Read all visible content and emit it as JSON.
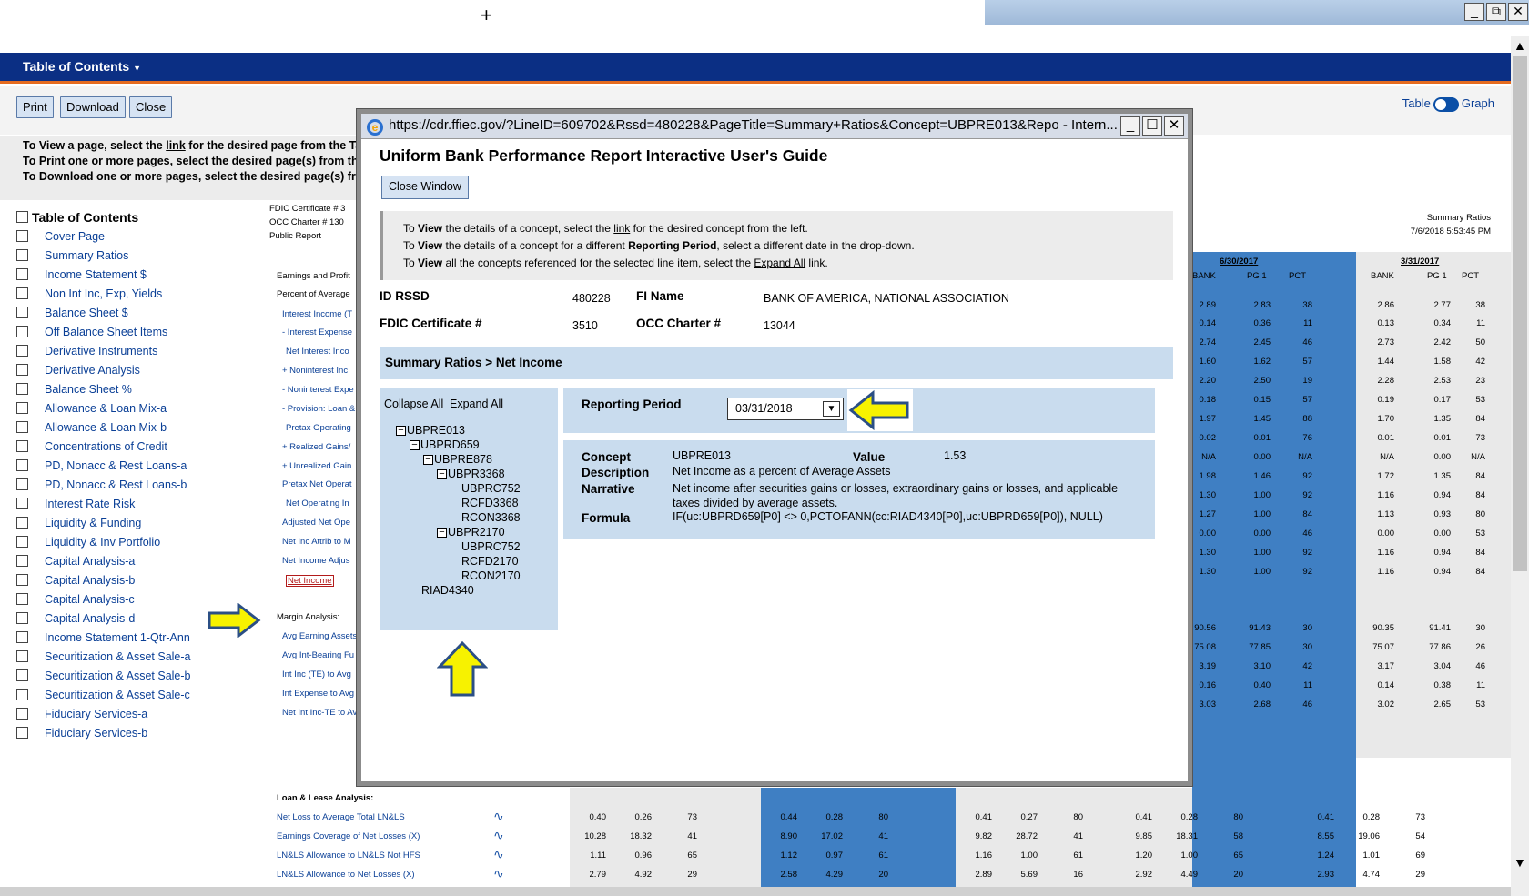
{
  "window": {
    "plus_cursor": "+",
    "controls": [
      "_",
      "⧉",
      "✕"
    ]
  },
  "nav": {
    "menu_label": "Table of Contents"
  },
  "toolbar": {
    "print": "Print",
    "download": "Download",
    "close": "Close",
    "table": "Table",
    "graph": "Graph"
  },
  "instructions": {
    "view_prefix": "To View a page, select the ",
    "view_link": "link",
    "view_suffix": " for the desired page from the Tab",
    "print": "To Print one or more pages, select the desired page(s) from the",
    "download": "To Download one or more pages, select the desired page(s) fror"
  },
  "toc": {
    "title": "Table of Contents",
    "items": [
      "Cover Page",
      "Summary Ratios",
      "Income Statement $",
      "Non Int Inc, Exp, Yields",
      "Balance Sheet $",
      "Off Balance Sheet Items",
      "Derivative Instruments",
      "Derivative Analysis",
      "Balance Sheet %",
      "Allowance & Loan Mix-a",
      "Allowance & Loan Mix-b",
      "Concentrations of Credit",
      "PD, Nonacc & Rest Loans-a",
      "PD, Nonacc & Rest Loans-b",
      "Interest Rate Risk",
      "Liquidity & Funding",
      "Liquidity & Inv Portfolio",
      "Capital Analysis-a",
      "Capital Analysis-b",
      "Capital Analysis-c",
      "Capital Analysis-d",
      "Income Statement 1-Qtr-Ann",
      "Securitization & Asset Sale-a",
      "Securitization & Asset Sale-b",
      "Securitization & Asset Sale-c",
      "Fiduciary Services-a",
      "Fiduciary Services-b"
    ]
  },
  "report": {
    "header_left": [
      "FDIC Certificate # 3",
      "OCC Charter # 130",
      "Public Report"
    ],
    "header_right": [
      "Summary Ratios",
      "7/6/2018 5:53:45 PM"
    ],
    "dates": [
      "6/30/2017",
      "3/31/2017"
    ],
    "col_heads": [
      "BANK",
      "PG 1",
      "PCT",
      "BANK",
      "PG 1",
      "PCT"
    ],
    "row_labels": [
      "Earnings and Profit",
      "Percent of Average",
      "Interest Income (T",
      "- Interest Expense",
      "Net Interest Inco",
      "+ Noninterest Inc",
      "- Noninterest Expe",
      "- Provision: Loan &",
      "Pretax Operating",
      "+ Realized Gains/",
      "+ Unrealized Gain",
      "Pretax Net Operat",
      "Net Operating In",
      "Adjusted Net Ope",
      "Net Inc Attrib to M",
      "Net Income Adjus",
      "Net Income",
      "Margin Analysis:",
      "Avg Earning Assets",
      "Avg Int-Bearing Fu",
      "Int Inc (TE) to Avg",
      "Int Expense to Avg",
      "Net Int Inc-TE to Av"
    ],
    "right_rows": [
      [
        "2.89",
        "2.83",
        "38",
        "2.86",
        "2.77",
        "38"
      ],
      [
        "0.14",
        "0.36",
        "11",
        "0.13",
        "0.34",
        "11"
      ],
      [
        "2.74",
        "2.45",
        "46",
        "2.73",
        "2.42",
        "50"
      ],
      [
        "1.60",
        "1.62",
        "57",
        "1.44",
        "1.58",
        "42"
      ],
      [
        "2.20",
        "2.50",
        "19",
        "2.28",
        "2.53",
        "23"
      ],
      [
        "0.18",
        "0.15",
        "57",
        "0.19",
        "0.17",
        "53"
      ],
      [
        "1.97",
        "1.45",
        "88",
        "1.70",
        "1.35",
        "84"
      ],
      [
        "0.02",
        "0.01",
        "76",
        "0.01",
        "0.01",
        "73"
      ],
      [
        "N/A",
        "0.00",
        "N/A",
        "N/A",
        "0.00",
        "N/A"
      ],
      [
        "1.98",
        "1.46",
        "92",
        "1.72",
        "1.35",
        "84"
      ],
      [
        "1.30",
        "1.00",
        "92",
        "1.16",
        "0.94",
        "84"
      ],
      [
        "1.27",
        "1.00",
        "84",
        "1.13",
        "0.93",
        "80"
      ],
      [
        "0.00",
        "0.00",
        "46",
        "0.00",
        "0.00",
        "53"
      ],
      [
        "1.30",
        "1.00",
        "92",
        "1.16",
        "0.94",
        "84"
      ],
      [
        "1.30",
        "1.00",
        "92",
        "1.16",
        "0.94",
        "84"
      ]
    ],
    "margin_rows": [
      [
        "90.56",
        "91.43",
        "30",
        "90.35",
        "91.41",
        "30"
      ],
      [
        "75.08",
        "77.85",
        "30",
        "75.07",
        "77.86",
        "26"
      ],
      [
        "3.19",
        "3.10",
        "42",
        "3.17",
        "3.04",
        "46"
      ],
      [
        "0.16",
        "0.40",
        "11",
        "0.14",
        "0.38",
        "11"
      ],
      [
        "3.03",
        "2.68",
        "46",
        "3.02",
        "2.65",
        "53"
      ]
    ],
    "loan_section": "Loan & Lease Analysis:",
    "loan_rows": [
      {
        "label": "Net Loss to Average Total LN&LS",
        "vals": [
          "0.40",
          "0.26",
          "73",
          "0.44",
          "0.28",
          "80",
          "0.41",
          "0.27",
          "80",
          "0.41",
          "0.28",
          "80",
          "0.41",
          "0.28",
          "73"
        ]
      },
      {
        "label": "Earnings Coverage of Net Losses (X)",
        "vals": [
          "10.28",
          "18.32",
          "41",
          "8.90",
          "17.02",
          "41",
          "9.82",
          "28.72",
          "41",
          "9.85",
          "18.31",
          "58",
          "8.55",
          "19.06",
          "54"
        ]
      },
      {
        "label": "LN&LS Allowance to LN&LS Not HFS",
        "vals": [
          "1.11",
          "0.96",
          "65",
          "1.12",
          "0.97",
          "61",
          "1.16",
          "1.00",
          "61",
          "1.20",
          "1.00",
          "65",
          "1.24",
          "1.01",
          "69"
        ]
      },
      {
        "label": "LN&LS Allowance to Net Losses (X)",
        "vals": [
          "2.79",
          "4.92",
          "29",
          "2.58",
          "4.29",
          "20",
          "2.89",
          "5.69",
          "16",
          "2.92",
          "4.49",
          "20",
          "2.93",
          "4.74",
          "29"
        ]
      }
    ]
  },
  "modal": {
    "url": "https://cdr.ffiec.gov/?LineID=609702&Rssd=480228&PageTitle=Summary+Ratios&Concept=UBPRE013&Repo - Intern...",
    "title": "Uniform Bank Performance Report Interactive User's Guide",
    "close_window": "Close Window",
    "instr1a": "To ",
    "instr1b": "View",
    "instr1c": " the details of a concept, select the ",
    "instr1d": "link",
    "instr1e": " for the desired concept from the left.",
    "instr2a": "To ",
    "instr2b": "View",
    "instr2c": " the details of a concept for a different ",
    "instr2d": "Reporting Period",
    "instr2e": ", select a different date in the drop-down.",
    "instr3a": "To ",
    "instr3b": "View",
    "instr3c": " all the concepts referenced for the selected line item, select the ",
    "instr3d": "Expand All",
    "instr3e": " link.",
    "id_rssd_label": "ID RSSD",
    "id_rssd": "480228",
    "fi_name_label": "FI Name",
    "fi_name": "BANK OF AMERICA, NATIONAL ASSOCIATION",
    "fdic_label": "FDIC Certificate #",
    "fdic": "3510",
    "occ_label": "OCC Charter #",
    "occ": "13044",
    "breadcrumb": "Summary Ratios > Net Income",
    "collapse_all": "Collapse All",
    "expand_all": "Expand All",
    "tree": [
      "UBPRE013",
      "UBPRD659",
      "UBPRE878",
      "UBPR3368",
      "UBPRC752",
      "RCFD3368",
      "RCON3368",
      "UBPR2170",
      "UBPRC752",
      "RCFD2170",
      "RCON2170",
      "RIAD4340"
    ],
    "reporting_period_label": "Reporting Period",
    "reporting_period": "03/31/2018",
    "concept_label": "Concept",
    "concept": "UBPRE013",
    "value_label": "Value",
    "value": "1.53",
    "description_label": "Description",
    "description": "Net Income as a percent of Average Assets",
    "narrative_label": "Narrative",
    "narrative": "Net income after securities gains or losses, extraordinary gains or losses, and applicable taxes divided by average assets.",
    "formula_label": "Formula",
    "formula": "IF(uc:UBPRD659[P0] <> 0,PCTOFANN(cc:RIAD4340[P0],uc:UBPRD659[P0]), NULL)"
  }
}
